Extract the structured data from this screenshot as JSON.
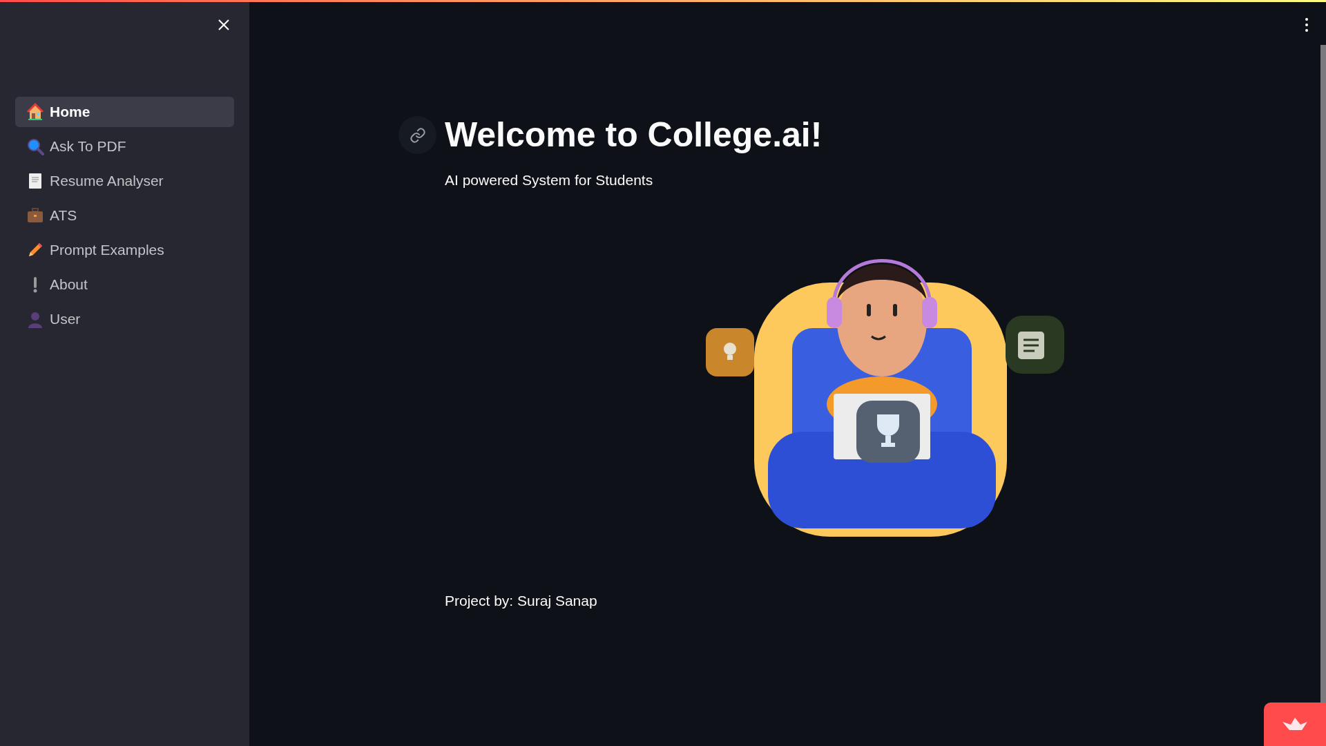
{
  "sidebar": {
    "items": [
      {
        "label": "Home",
        "selected": true
      },
      {
        "label": "Ask To PDF",
        "selected": false
      },
      {
        "label": "Resume Analyser",
        "selected": false
      },
      {
        "label": "ATS",
        "selected": false
      },
      {
        "label": "Prompt Examples",
        "selected": false
      },
      {
        "label": "About",
        "selected": false
      },
      {
        "label": "User",
        "selected": false
      }
    ]
  },
  "main": {
    "title": "Welcome to College.ai!",
    "subtitle": "AI powered System for Students",
    "footer": "Project by: Suraj Sanap"
  }
}
